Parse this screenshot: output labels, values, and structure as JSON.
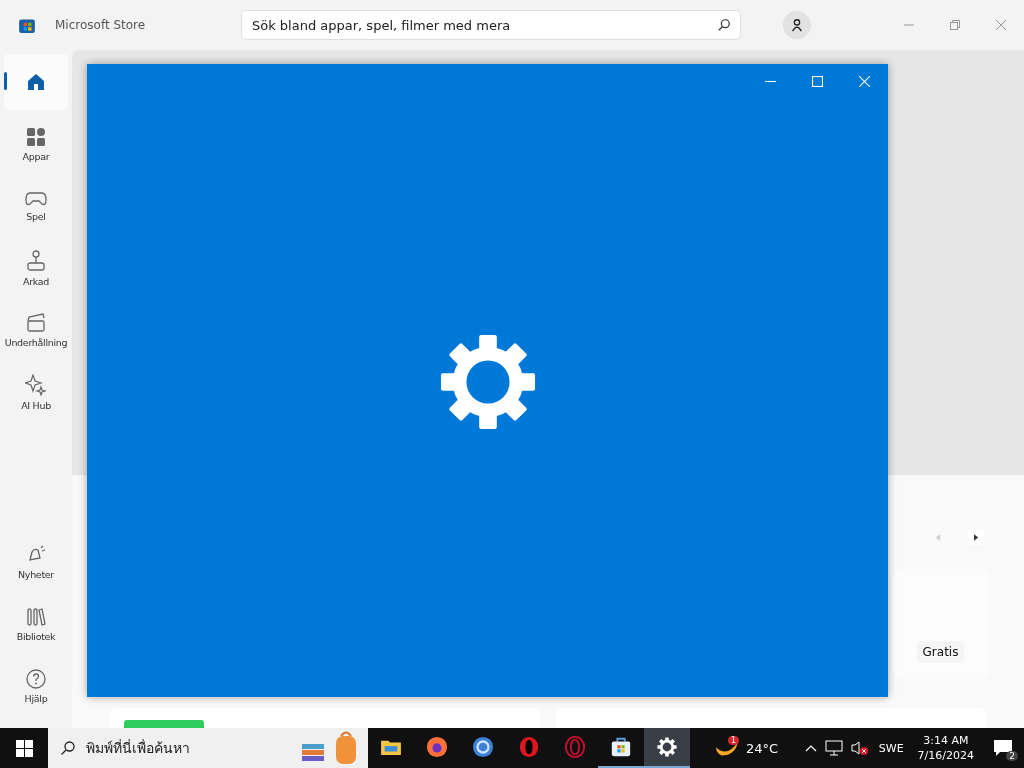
{
  "store": {
    "title": "Microsoft Store",
    "search": {
      "placeholder": "Sök bland appar, spel, filmer med mera"
    },
    "nav": [
      {
        "kind": "home",
        "selected": true
      },
      {
        "kind": "apps",
        "label": "Appar",
        "selected": false
      },
      {
        "kind": "games",
        "label": "Spel",
        "selected": false
      },
      {
        "kind": "arcade",
        "label": "Arkad",
        "selected": false
      },
      {
        "kind": "movies",
        "label": "Underhållning",
        "selected": false
      },
      {
        "kind": "ai",
        "label": "AI Hub",
        "selected": false
      }
    ],
    "nav_bottom": [
      {
        "kind": "news",
        "label": "Nyheter",
        "selected": false
      },
      {
        "kind": "library",
        "label": "Bibliotek",
        "selected": false
      },
      {
        "kind": "help",
        "label": "Hjälp",
        "selected": false
      }
    ],
    "carousel": {
      "prev_disabled": true,
      "next_disabled": false
    },
    "card": {
      "price": "Gratis"
    }
  },
  "splash": {
    "kind": "settings"
  },
  "taskbar": {
    "search": {
      "placeholder": "พิมพ์ที่นี่เพื่อค้นหา"
    },
    "apps": [
      {
        "kind": "folder",
        "open": false,
        "selected": false
      },
      {
        "kind": "firefox",
        "open": false,
        "selected": false
      },
      {
        "kind": "chromium",
        "open": false,
        "selected": false
      },
      {
        "kind": "opera",
        "open": false,
        "selected": false
      },
      {
        "kind": "opera-gx",
        "open": false,
        "selected": false
      },
      {
        "kind": "store",
        "open": true,
        "selected": false
      },
      {
        "kind": "settings",
        "open": true,
        "selected": true
      }
    ],
    "weather": {
      "temp": "24°C",
      "badge": "1"
    },
    "language": "SWE",
    "time": "3:14 AM",
    "date": "7/16/2024",
    "notifications": "2"
  }
}
